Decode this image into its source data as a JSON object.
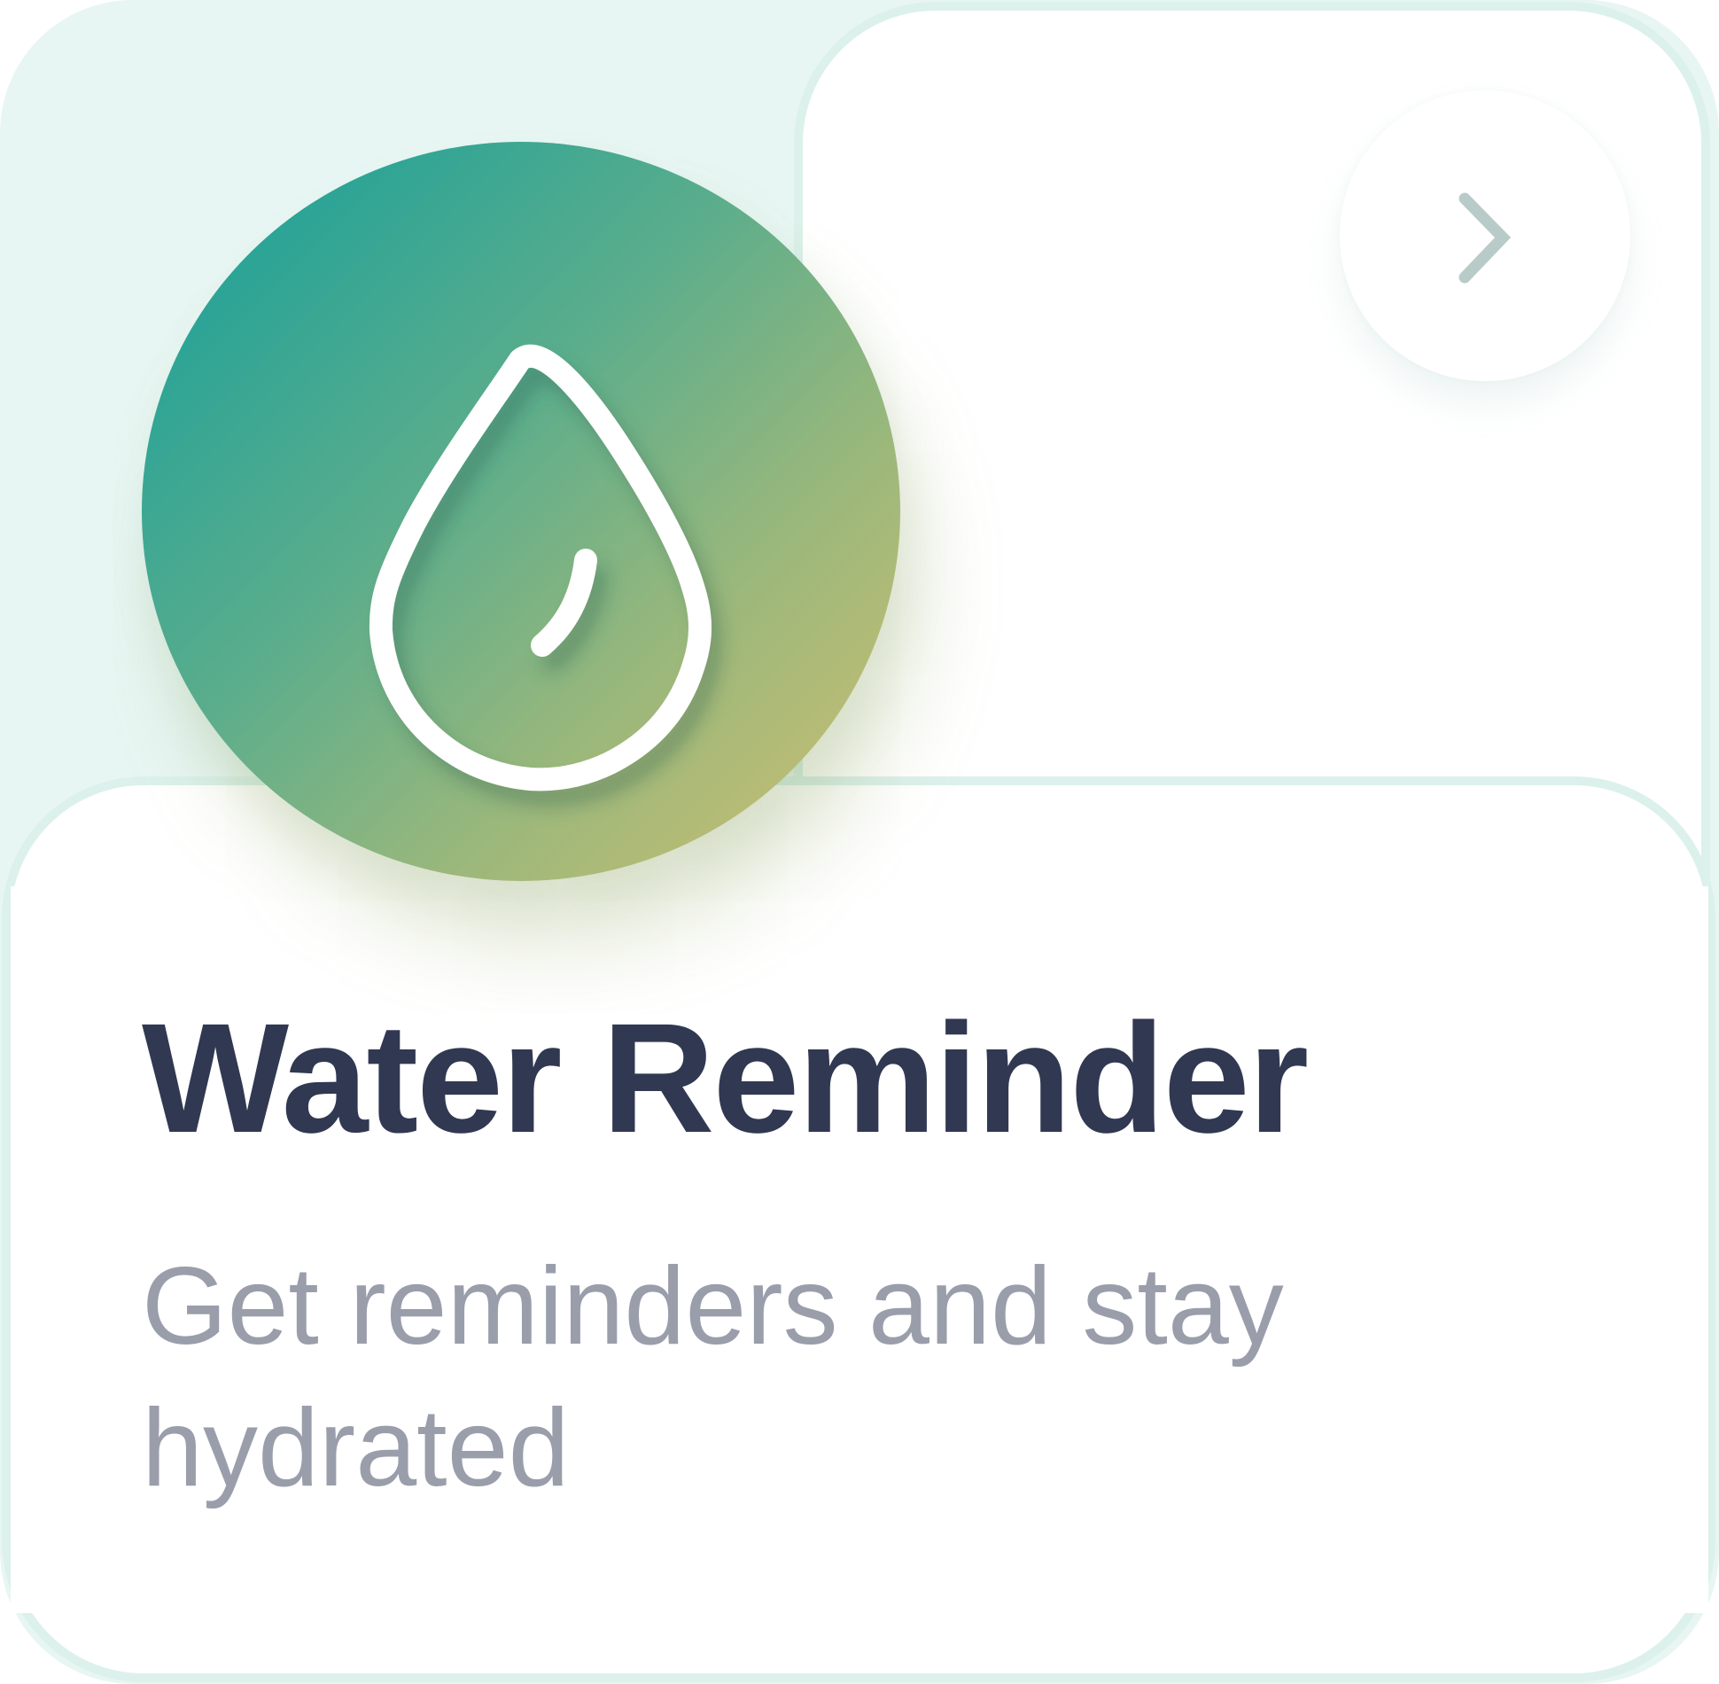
{
  "card": {
    "title": "Water Reminder",
    "description": "Get reminders and stay hydrated",
    "icon": "water-drop-icon",
    "action_icon": "chevron-right-icon"
  },
  "colors": {
    "background": "#e8f6f3",
    "card_border": "#dcf1ec",
    "title": "#313852",
    "description": "#9a9eab",
    "gradient_start": "#129f9c",
    "gradient_end": "#d0bf70",
    "chevron": "#b9cbc9"
  }
}
